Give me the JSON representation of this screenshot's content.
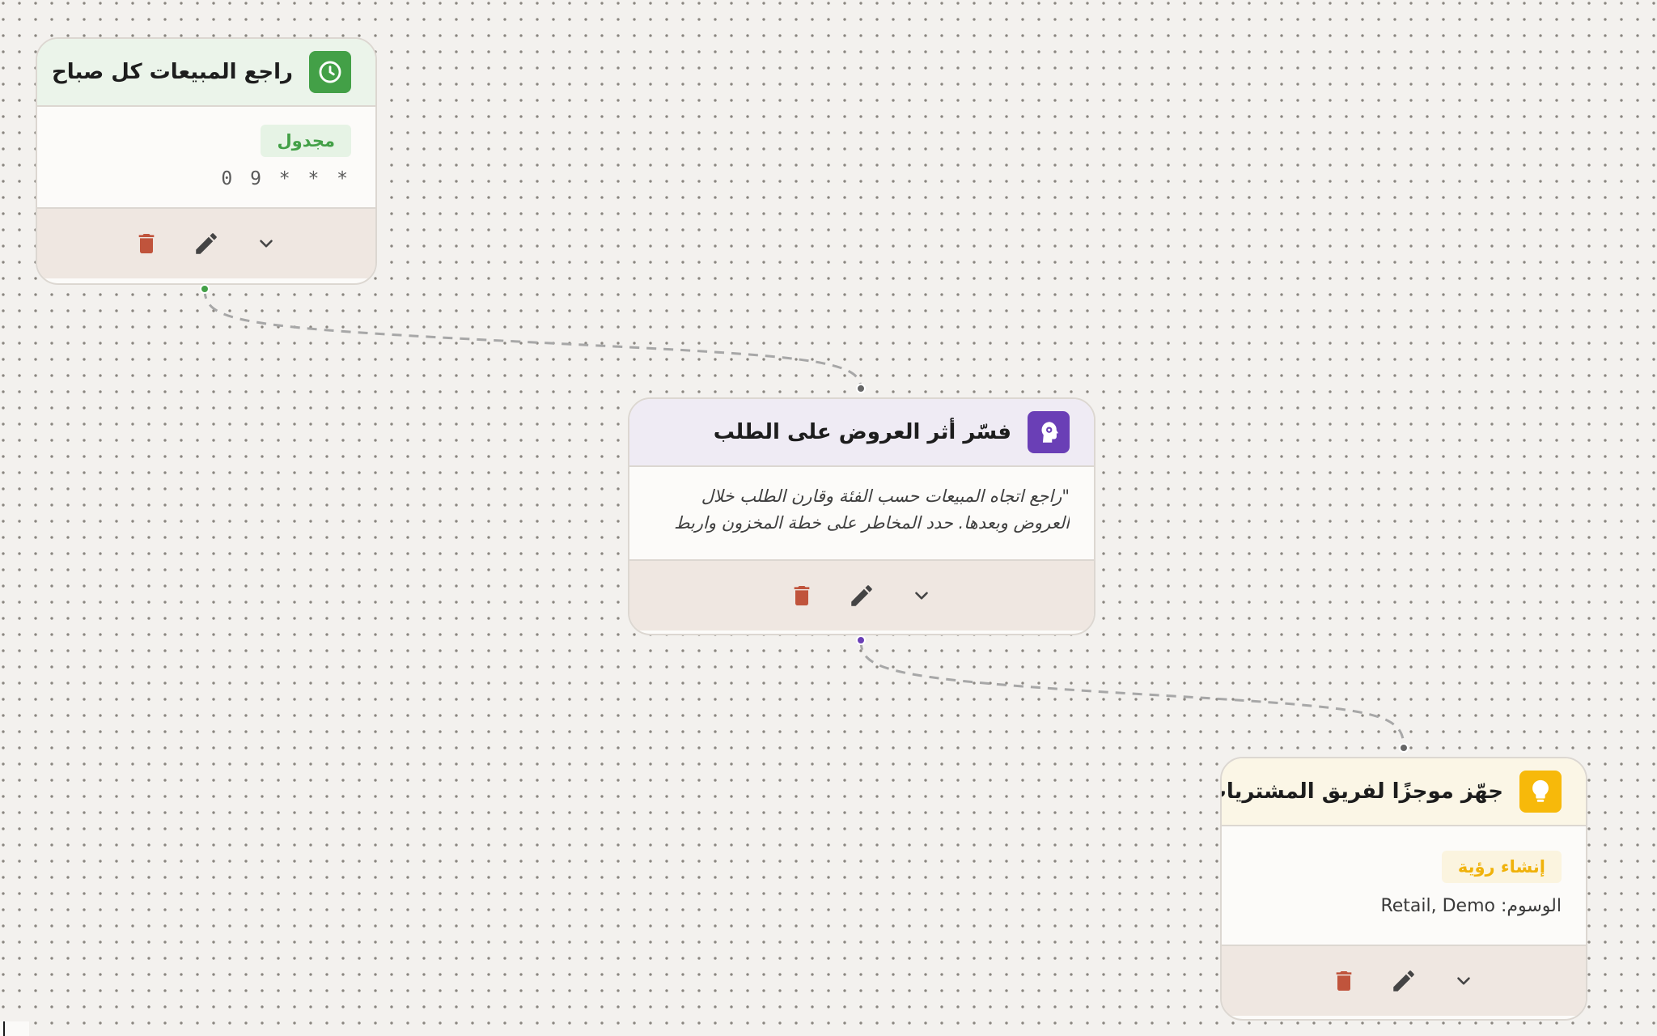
{
  "colors": {
    "trigger": "#43a047",
    "trigger_header": "#ebf4ea",
    "prompt": "#6a3fb6",
    "prompt_header": "#efebf4",
    "insight": "#f7b90a",
    "insight_header": "#fbf6e6",
    "delete": "#c0543c",
    "tool": "#444444",
    "wire": "#a7a7a7"
  },
  "nodes": [
    {
      "type": "schedule-trigger",
      "icon": "clock-icon",
      "title": "راجع المبيعات كل صباح",
      "badge": "مجدول",
      "cron": "0 9 * * *"
    },
    {
      "type": "ai-prompt",
      "icon": "brain-gear-icon",
      "title": "فسّر أثر العروض على الطلب",
      "prompt_lines": [
        "\"راجع اتجاه المبيعات حسب الفئة وقارن الطلب خلال",
        "العروض وبعدها. حدد المخاطر على خطة المخزون واربط"
      ]
    },
    {
      "type": "insight",
      "icon": "lightbulb-icon",
      "title": "جهّز موجزًا لفريق المشتريات",
      "badge": "إنشاء رؤية",
      "tags": "الوسوم: Retail, Demo"
    }
  ]
}
